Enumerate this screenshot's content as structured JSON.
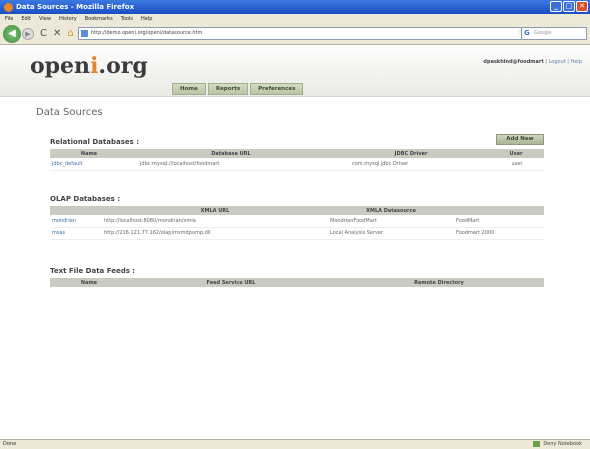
{
  "window": {
    "title": "Data Sources - Mozilla Firefox",
    "min": "_",
    "max": "□",
    "close": "✕"
  },
  "menu": [
    "File",
    "Edit",
    "View",
    "History",
    "Bookmarks",
    "Tools",
    "Help"
  ],
  "nav": {
    "back_glyph": "◀",
    "fwd_glyph": "▶",
    "reload_glyph": "C",
    "stop_glyph": "✕",
    "home_glyph": "⌂",
    "url": "http://demo.openi.org/openi/datasource.htm",
    "search_placeholder": "Google",
    "search_glyph": "G",
    "star_glyph": "☆"
  },
  "brand": {
    "logo_prefix": "open",
    "logo_dot": "i",
    "logo_suffix": ".org"
  },
  "user": {
    "name": "dpaskhind@foodmart",
    "sep1": " | ",
    "logout": "Logout",
    "sep2": " | ",
    "help": "Help"
  },
  "tabs": [
    "Home",
    "Reports",
    "Preferences"
  ],
  "page_title": "Data Sources",
  "add_new_label": "Add New",
  "relational": {
    "title": "Relational Databases :",
    "headers": [
      "Name",
      "Database URL",
      "JDBC Driver",
      "User"
    ],
    "rows": [
      [
        "jdbc_default",
        "jdbc:mysql://localhost/foodmart",
        "com.mysql.jdbc.Driver",
        "user"
      ]
    ]
  },
  "olap": {
    "title": "OLAP Databases :",
    "headers": [
      "",
      "XMLA URL",
      "XMLA Datasource",
      ""
    ],
    "rows": [
      [
        "mondrian",
        "http://localhost:8080/mondrian/xmla",
        "MondrianFoodMart",
        "FoodMart"
      ],
      [
        "msas",
        "http://216.121.77.162/olap/msmdpump.dll",
        "Local Analysis Server",
        "Foodmart 2000"
      ]
    ]
  },
  "textfile": {
    "title": "Text File Data Feeds :",
    "headers": [
      "Name",
      "Feed Service URL",
      "Remote Directory"
    ]
  },
  "status": {
    "left": "Done",
    "right": "Deny Notebook"
  },
  "colors": {
    "titlebar": "#1a4fc4",
    "chrome": "#ece9d8",
    "table_header": "#c9cbc1",
    "link": "#3a6ea8",
    "logo_accent": "#e8852c",
    "tab_bg": "#b9c5a4"
  }
}
